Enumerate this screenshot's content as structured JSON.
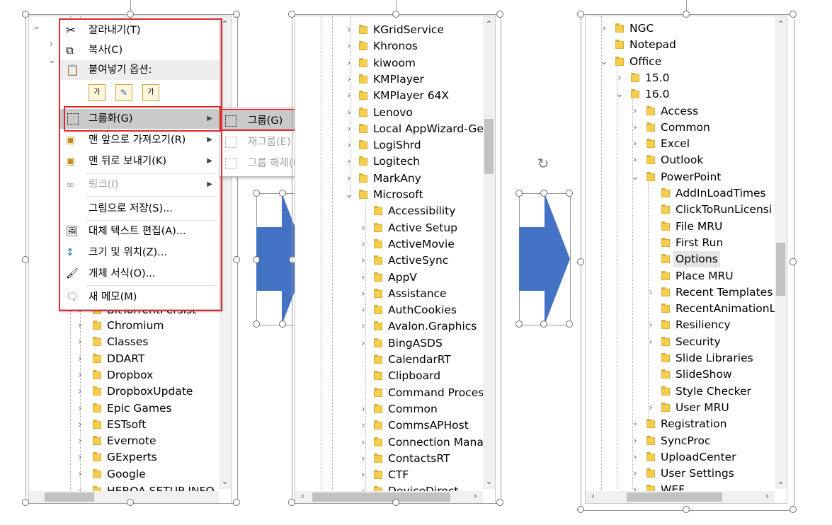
{
  "panel1": {
    "tree_items": [
      "Chromium",
      "Classes",
      "DDART",
      "Dropbox",
      "DropboxUpdate",
      "Epic Games",
      "ESTsoft",
      "Evernote",
      "GExperts",
      "Google"
    ],
    "partial_top": "BitTorrentPersist",
    "partial_bottom": "HEROA SETUP INFO"
  },
  "context_menu": {
    "cut": "잘라내기(T)",
    "copy": "복사(C)",
    "paste_options": "붙여넣기 옵션:",
    "group": "그룹화(G)",
    "bring_front": "맨 앞으로 가져오기(R)",
    "send_back": "맨 뒤로 보내기(K)",
    "link": "링크(I)",
    "save_picture": "그림으로 저장(S)...",
    "alt_text": "대체 텍스트 편집(A)...",
    "size_position": "크기 및 위치(Z)...",
    "format_object": "개체 서식(O)...",
    "new_comment": "새 메모(M)"
  },
  "submenu": {
    "group": "그룹(G)",
    "regroup": "재그룹(E)",
    "ungroup": "그룹 해제(U)"
  },
  "panel2": {
    "items_top": [
      "KGridService",
      "Khronos",
      "kiwoom",
      "KMPlayer",
      "KMPlayer 64X",
      "Lenovo",
      "Local AppWizard-Ge",
      "LogiShrd",
      "Logitech",
      "MarkAny"
    ],
    "expanded": "Microsoft",
    "children": [
      "Accessibility",
      "Active Setup",
      "ActiveMovie",
      "ActiveSync",
      "AppV",
      "Assistance",
      "AuthCookies",
      "Avalon.Graphics",
      "BingASDS",
      "CalendarRT",
      "Clipboard",
      "Command Proces",
      "Common",
      "CommsAPHost",
      "Connection Mana",
      "ContactsRT",
      "CTF"
    ],
    "partial_bottom": "DeviceDirect"
  },
  "panel3": {
    "ngc": "NGC",
    "notepad": "Notepad",
    "office": "Office",
    "v15": "15.0",
    "v16": "16.0",
    "office_children": [
      "Access",
      "Common",
      "Excel",
      "Outlook"
    ],
    "powerpoint": "PowerPoint",
    "pp_children": [
      "AddInLoadTimes",
      "ClickToRunLicensi",
      "File MRU",
      "First Run",
      "Options",
      "Place MRU",
      "Recent Templates",
      "RecentAnimationL",
      "Resiliency",
      "Security",
      "Slide Libraries",
      "SlideShow",
      "Style Checker",
      "User MRU"
    ],
    "after": [
      "Registration",
      "SyncProc",
      "UploadCenter",
      "User Settings"
    ],
    "partial_bottom": "WEF"
  },
  "colors": {
    "accent_red": "#e0282f",
    "arrow_blue": "#4472c4",
    "folder": "#f6cd4c"
  }
}
